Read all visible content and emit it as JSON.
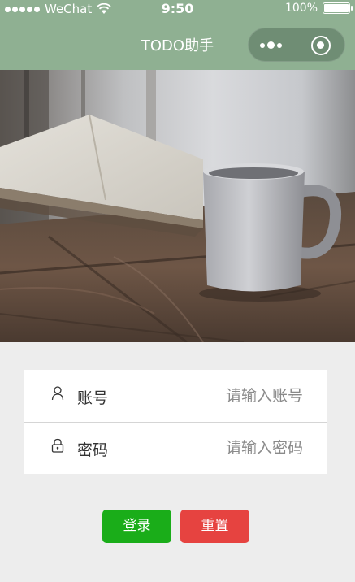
{
  "statusbar": {
    "carrier": "WeChat",
    "time": "9:50",
    "battery": "100%"
  },
  "navbar": {
    "title": "TODO助手"
  },
  "form": {
    "account": {
      "label": "账号",
      "placeholder": "请输入账号",
      "value": ""
    },
    "password": {
      "label": "密码",
      "placeholder": "请输入密码",
      "value": ""
    }
  },
  "buttons": {
    "login": "登录",
    "reset": "重置"
  },
  "colors": {
    "navbar": "#8fb092",
    "login": "#1aad19",
    "reset": "#e64340",
    "background": "#ededed"
  },
  "icons": {
    "account": "user-icon",
    "password": "lock-icon",
    "menu": "more-dots-icon",
    "close": "close-circle-icon"
  }
}
